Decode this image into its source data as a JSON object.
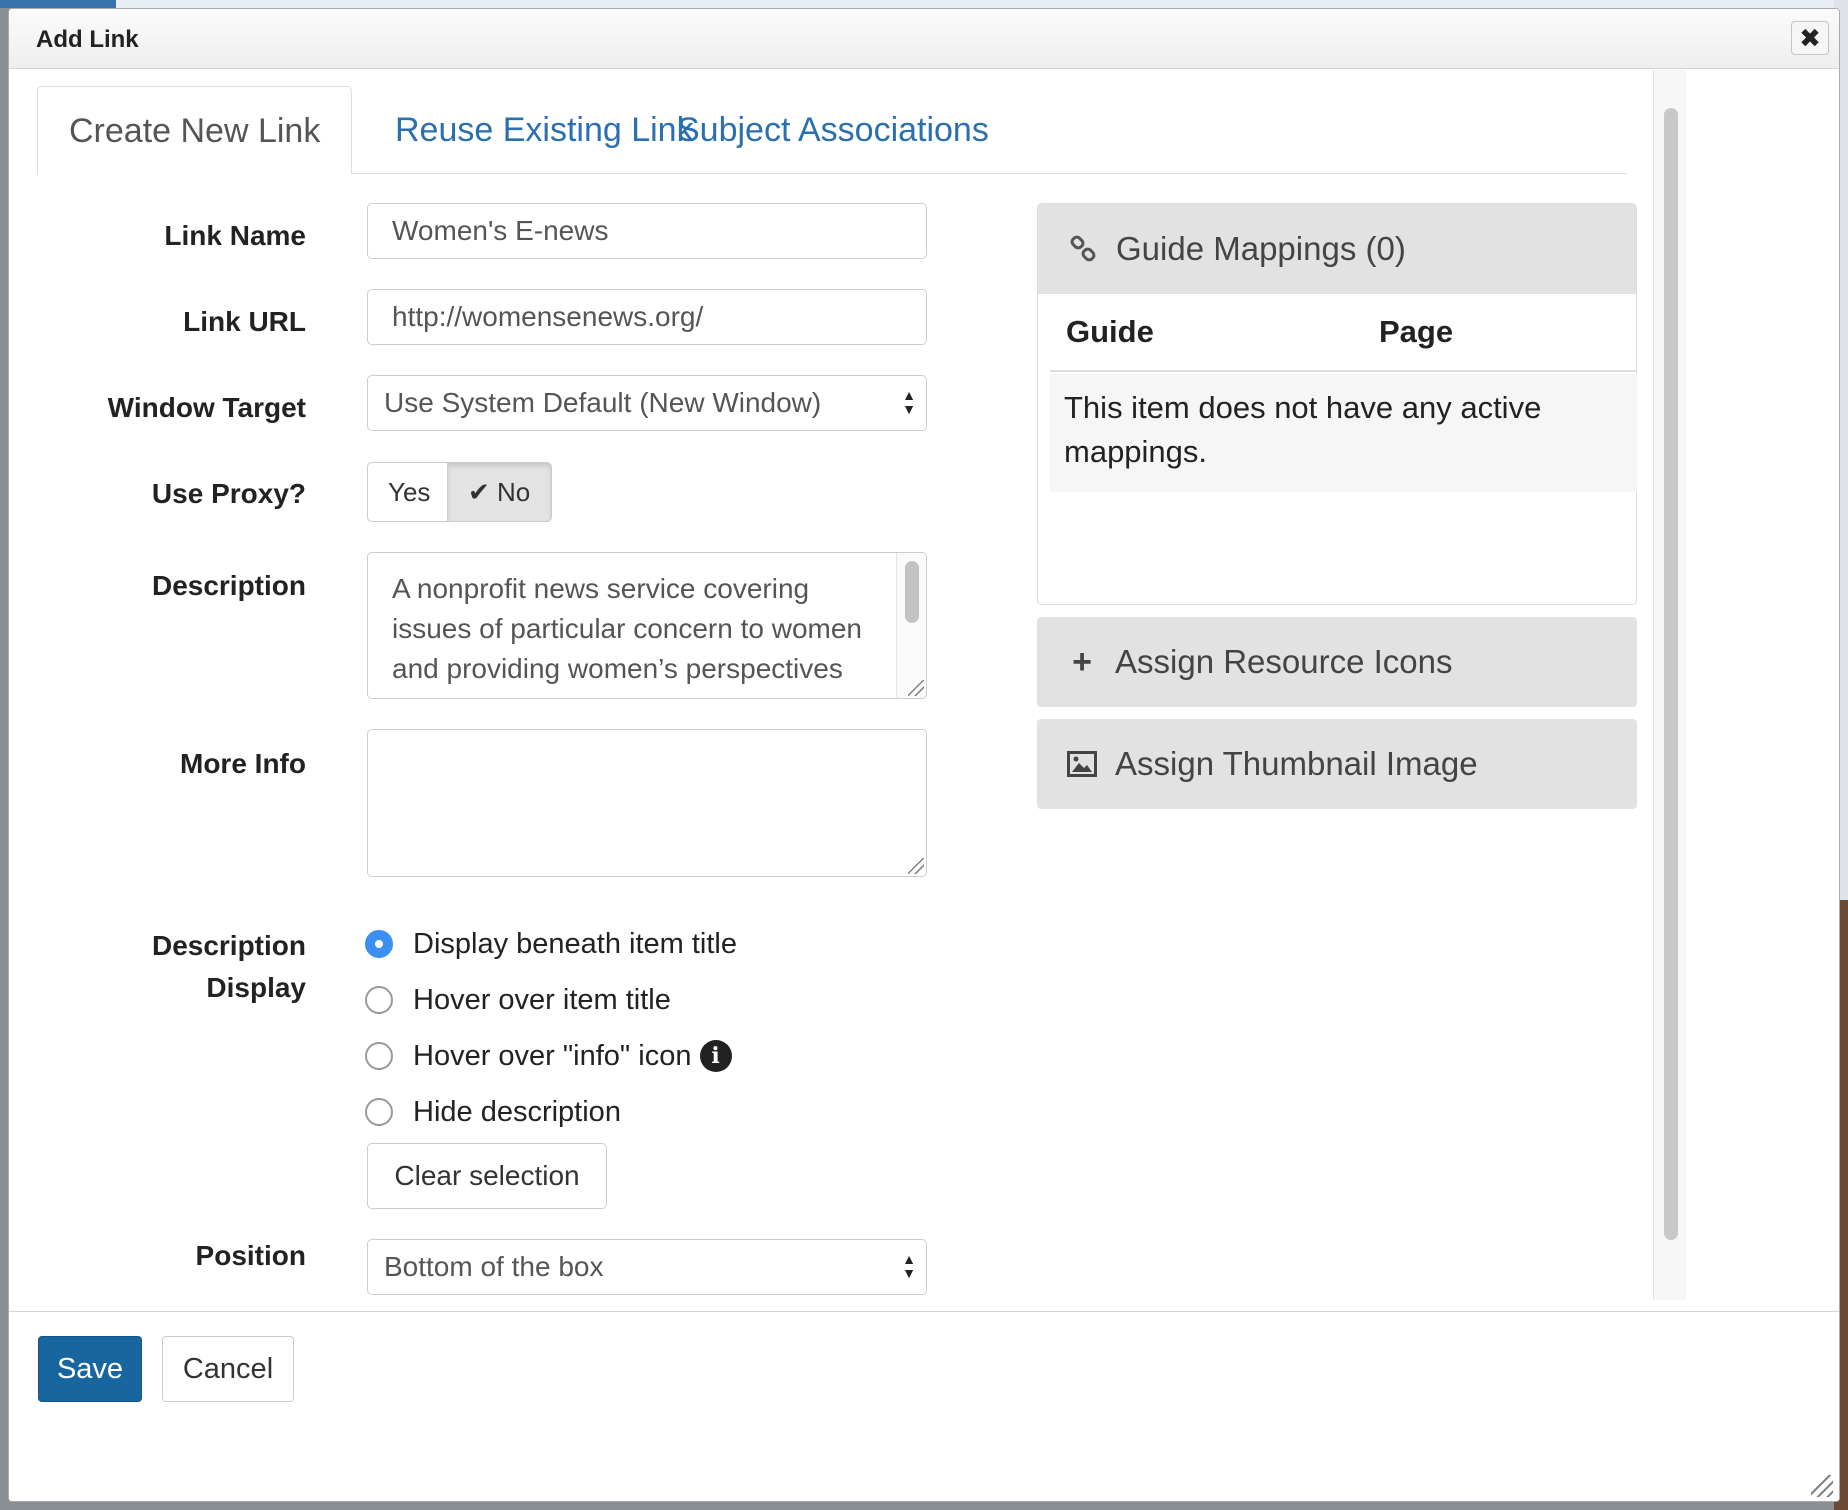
{
  "dialog": {
    "title": "Add Link",
    "close_symbol": "✖"
  },
  "tabs": [
    {
      "label": "Create New Link",
      "active": true
    },
    {
      "label": "Reuse Existing Link",
      "active": false
    },
    {
      "label": "Subject Associations",
      "active": false
    }
  ],
  "form": {
    "link_name": {
      "label": "Link Name",
      "value": "Women's E-news"
    },
    "link_url": {
      "label": "Link URL",
      "value": "http://womensenews.org/"
    },
    "window_target": {
      "label": "Window Target",
      "selected": "Use System Default (New Window)"
    },
    "use_proxy": {
      "label": "Use Proxy?",
      "yes_label": "Yes",
      "no_label": "No",
      "selected": "No"
    },
    "description": {
      "label": "Description",
      "value": "A nonprofit news service covering issues of particular concern to women and providing women’s perspectives on public policy"
    },
    "more_info": {
      "label": "More Info",
      "value": ""
    },
    "description_display": {
      "label_line1": "Description",
      "label_line2": "Display",
      "options": [
        {
          "label": "Display beneath item title",
          "checked": true
        },
        {
          "label": "Hover over item title",
          "checked": false
        },
        {
          "label": "Hover over \"info\" icon",
          "checked": false,
          "icon": "info-icon"
        },
        {
          "label": "Hide description",
          "checked": false
        }
      ],
      "clear_label": "Clear selection"
    },
    "position": {
      "label": "Position",
      "selected": "Bottom of the box"
    }
  },
  "side": {
    "guide_mappings": {
      "title": "Guide Mappings (0)",
      "icon": "link-icon",
      "columns": [
        "Guide",
        "Page"
      ],
      "empty_message": "This item does not have any active mappings."
    },
    "resource_icons": {
      "title": "Assign Resource Icons",
      "icon": "plus-icon"
    },
    "thumbnail": {
      "title": "Assign Thumbnail Image",
      "icon": "image-icon"
    }
  },
  "footer": {
    "save_label": "Save",
    "cancel_label": "Cancel"
  },
  "colors": {
    "primary": "#1866a0",
    "tab_link": "#2a6fb0",
    "radio_on": "#3b8ff0"
  }
}
